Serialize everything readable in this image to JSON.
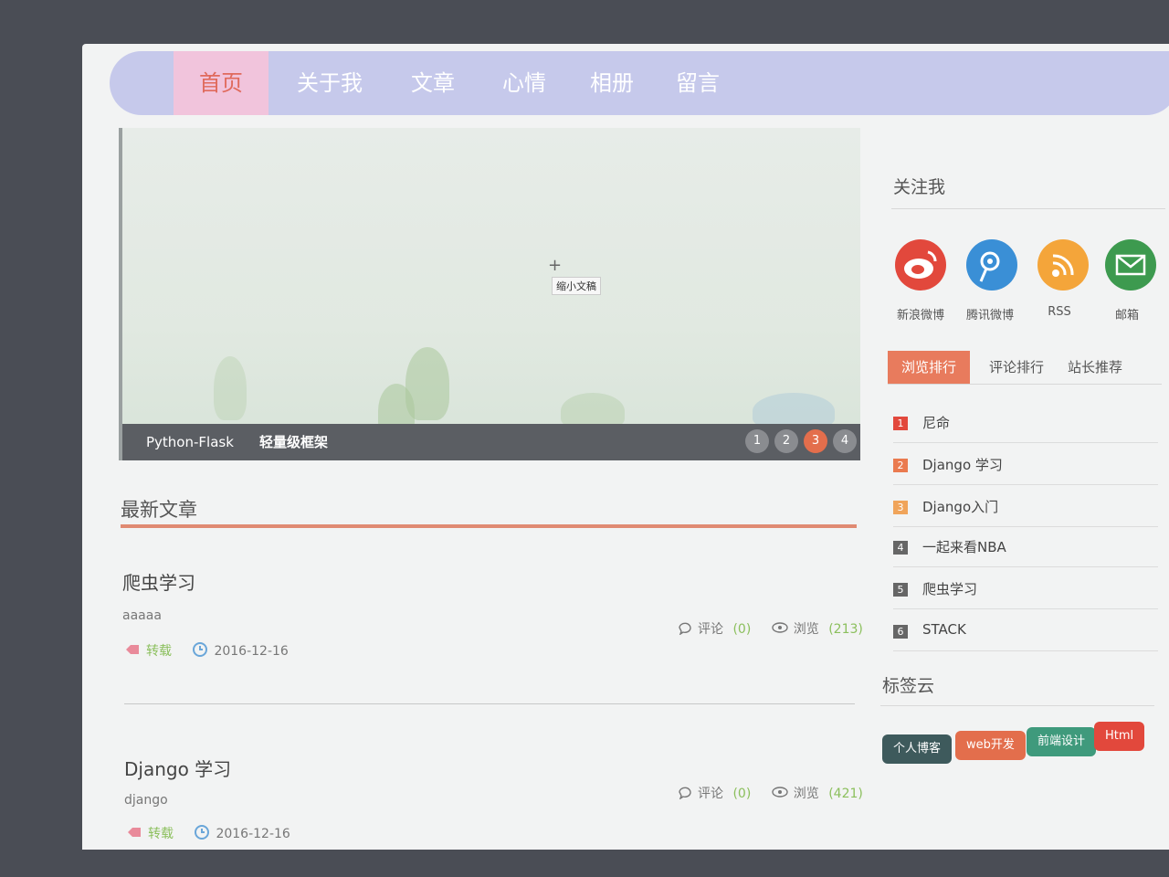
{
  "nav": {
    "items": [
      "首页",
      "关于我",
      "文章",
      "心情",
      "相册",
      "留言"
    ],
    "active": "首页"
  },
  "slider": {
    "tooltip": "缩小文稿",
    "caption_left": "Python-Flask",
    "caption_right": "轻量级框架",
    "dots": [
      "1",
      "2",
      "3",
      "4"
    ],
    "active_dot": "3"
  },
  "latest": {
    "title": "最新文章",
    "posts": [
      {
        "title": "爬虫学习",
        "desc": "aaaaa",
        "tag": "转载",
        "date": "2016-12-16",
        "comments_label": "评论",
        "comments": "(0)",
        "views_label": "浏览",
        "views": "(213)"
      },
      {
        "title": "Django 学习",
        "desc": "django",
        "tag": "转载",
        "date": "2016-12-16",
        "comments_label": "评论",
        "comments": "(0)",
        "views_label": "浏览",
        "views": "(421)"
      }
    ]
  },
  "follow": {
    "title": "关注我",
    "items": [
      {
        "label": "新浪微博",
        "icon": "weibo-icon",
        "color": "#e2483c"
      },
      {
        "label": "腾讯微博",
        "icon": "tencent-weibo-icon",
        "color": "#3a8fd6"
      },
      {
        "label": "RSS",
        "icon": "rss-icon",
        "color": "#f4a53a"
      },
      {
        "label": "邮箱",
        "icon": "mail-icon",
        "color": "#3d9a4f"
      }
    ]
  },
  "rank_tabs": {
    "items": [
      "浏览排行",
      "评论排行",
      "站长推荐"
    ],
    "active": "浏览排行"
  },
  "rank_list": [
    {
      "num": "1",
      "text": "尼命",
      "color": "#e2483c"
    },
    {
      "num": "2",
      "text": "Django 学习",
      "color": "#ea7a4f"
    },
    {
      "num": "3",
      "text": "Django入门",
      "color": "#f0a45a"
    },
    {
      "num": "4",
      "text": "一起来看NBA",
      "color": "#666666"
    },
    {
      "num": "5",
      "text": "爬虫学习",
      "color": "#666666"
    },
    {
      "num": "6",
      "text": "STACK",
      "color": "#666666"
    }
  ],
  "tag_cloud": {
    "title": "标签云",
    "tags": [
      {
        "text": "个人博客",
        "color": "#3e5a5c"
      },
      {
        "text": "web开发",
        "color": "#e36e4c"
      },
      {
        "text": "前端设计",
        "color": "#3f9a7c"
      },
      {
        "text": "Html",
        "color": "#e2483c"
      }
    ]
  }
}
